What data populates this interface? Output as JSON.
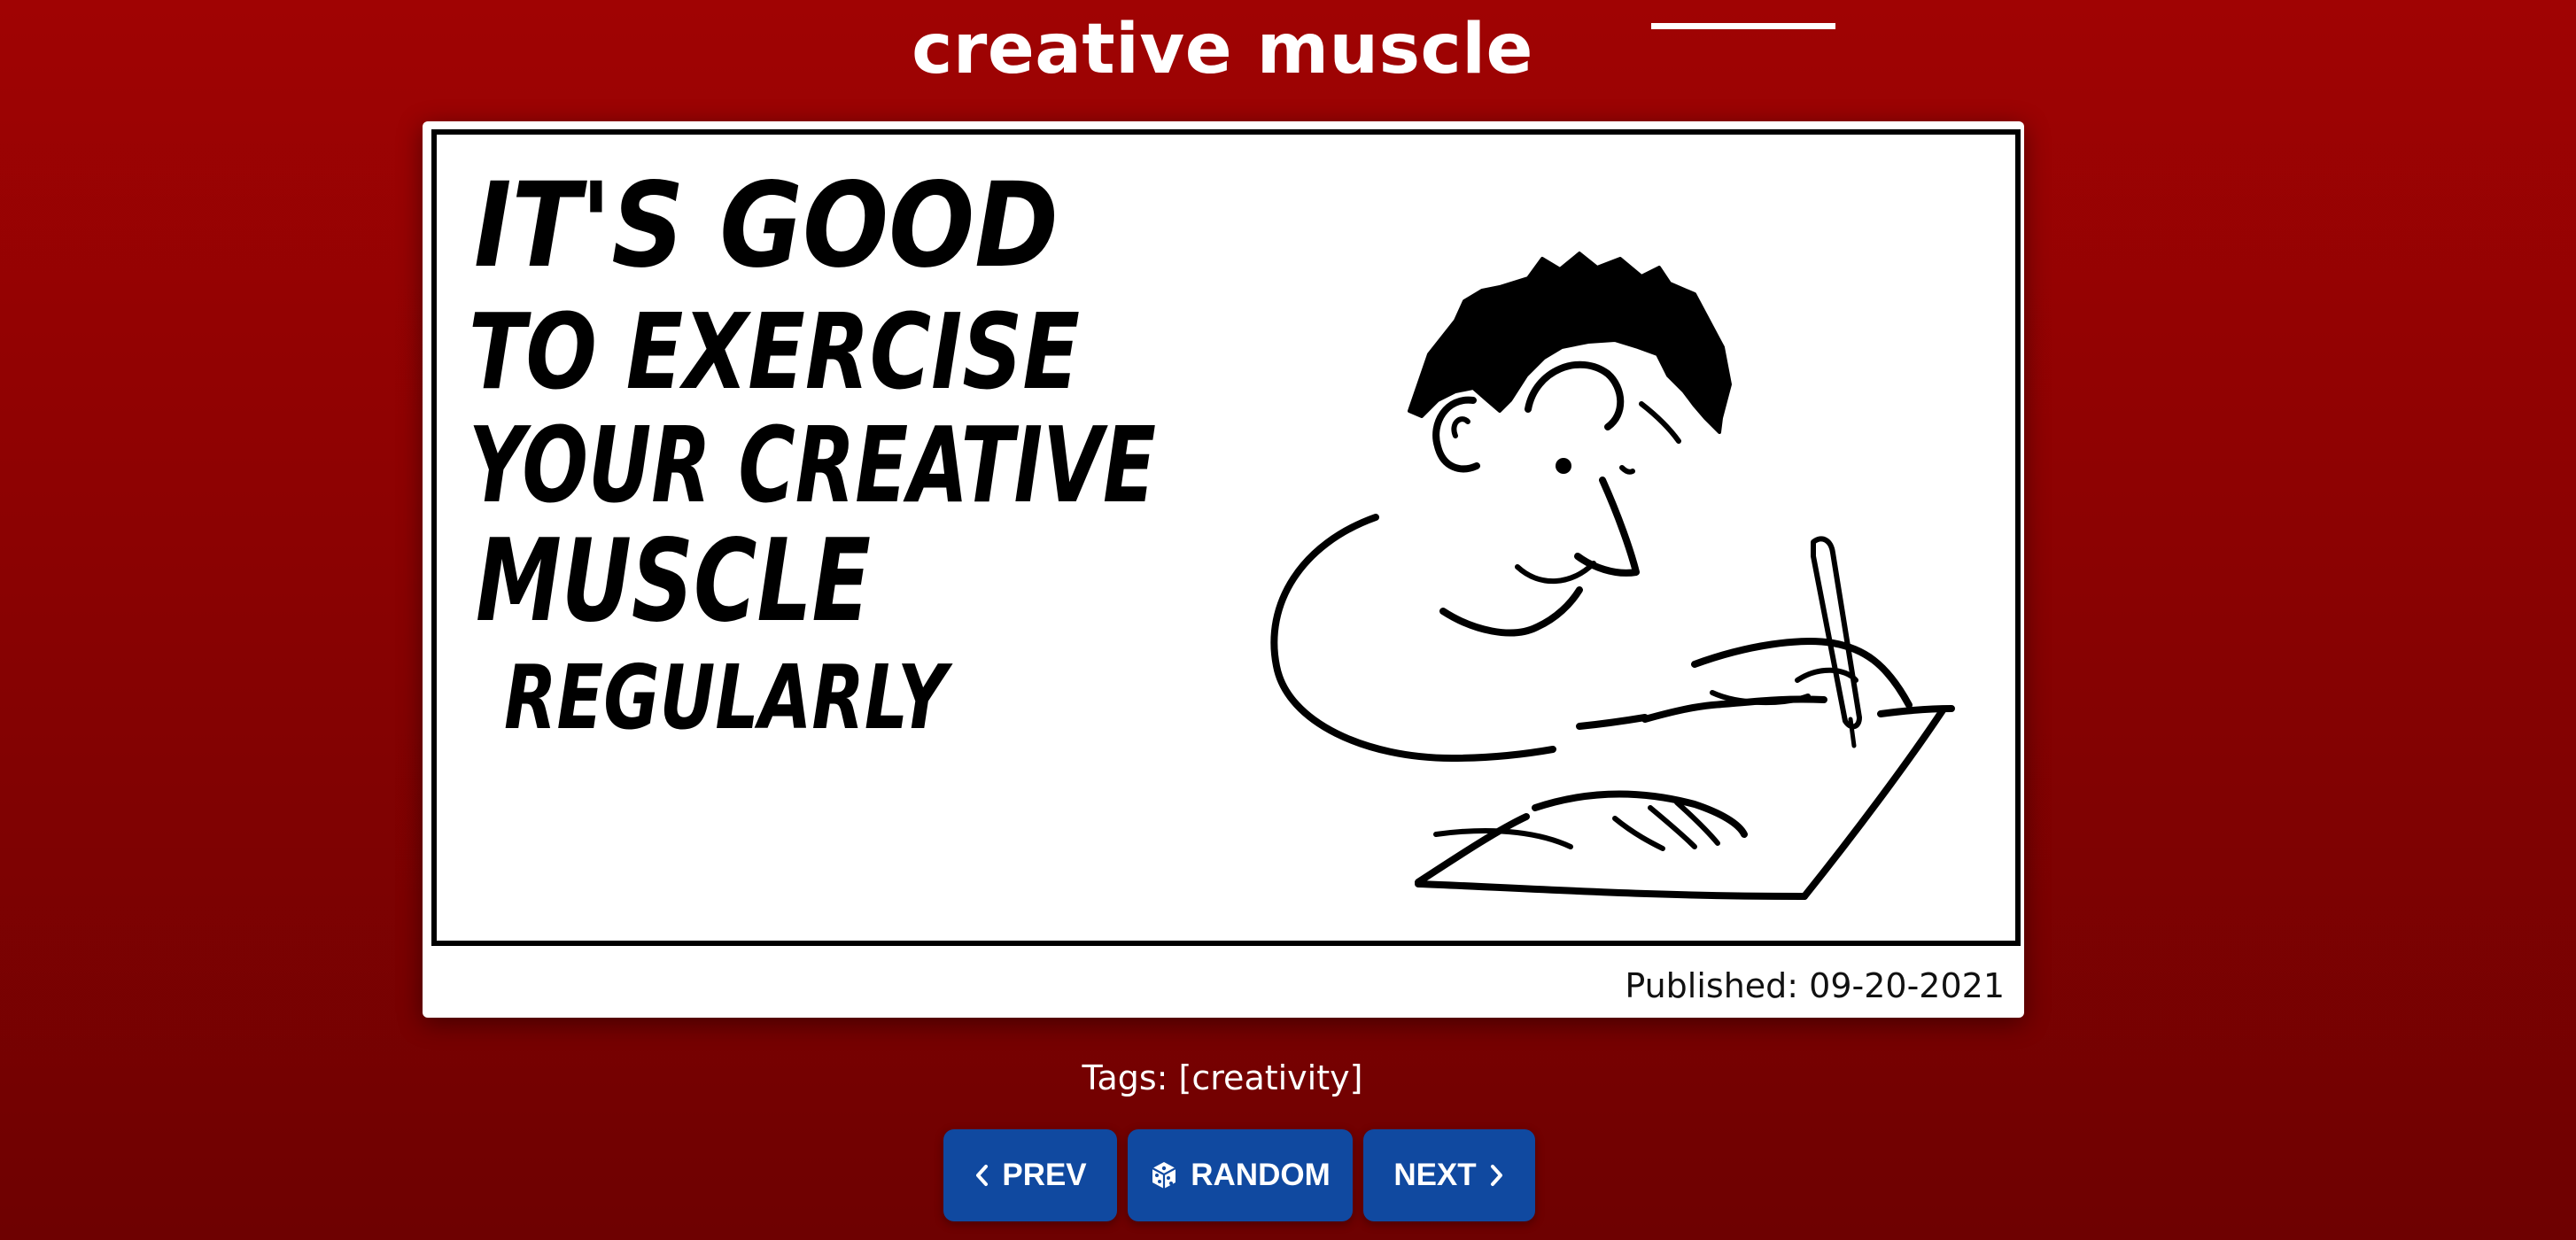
{
  "page": {
    "title": "creative muscle"
  },
  "comic": {
    "lines": [
      "IT'S GOOD",
      "TO EXERCISE",
      "YOUR CREATIVE",
      "MUSCLE",
      "REGULARLY"
    ],
    "published": "Published: 09-20-2021"
  },
  "tags": {
    "text": "Tags: [creativity]"
  },
  "nav": {
    "prev_label": "PREV",
    "random_label": "RANDOM",
    "next_label": "NEXT",
    "prev_icon": "chevron-left-icon",
    "random_icon": "dice-icon",
    "next_icon": "chevron-right-icon"
  },
  "colors": {
    "background": "#a00303",
    "button": "#1049a0",
    "card": "#ffffff"
  }
}
